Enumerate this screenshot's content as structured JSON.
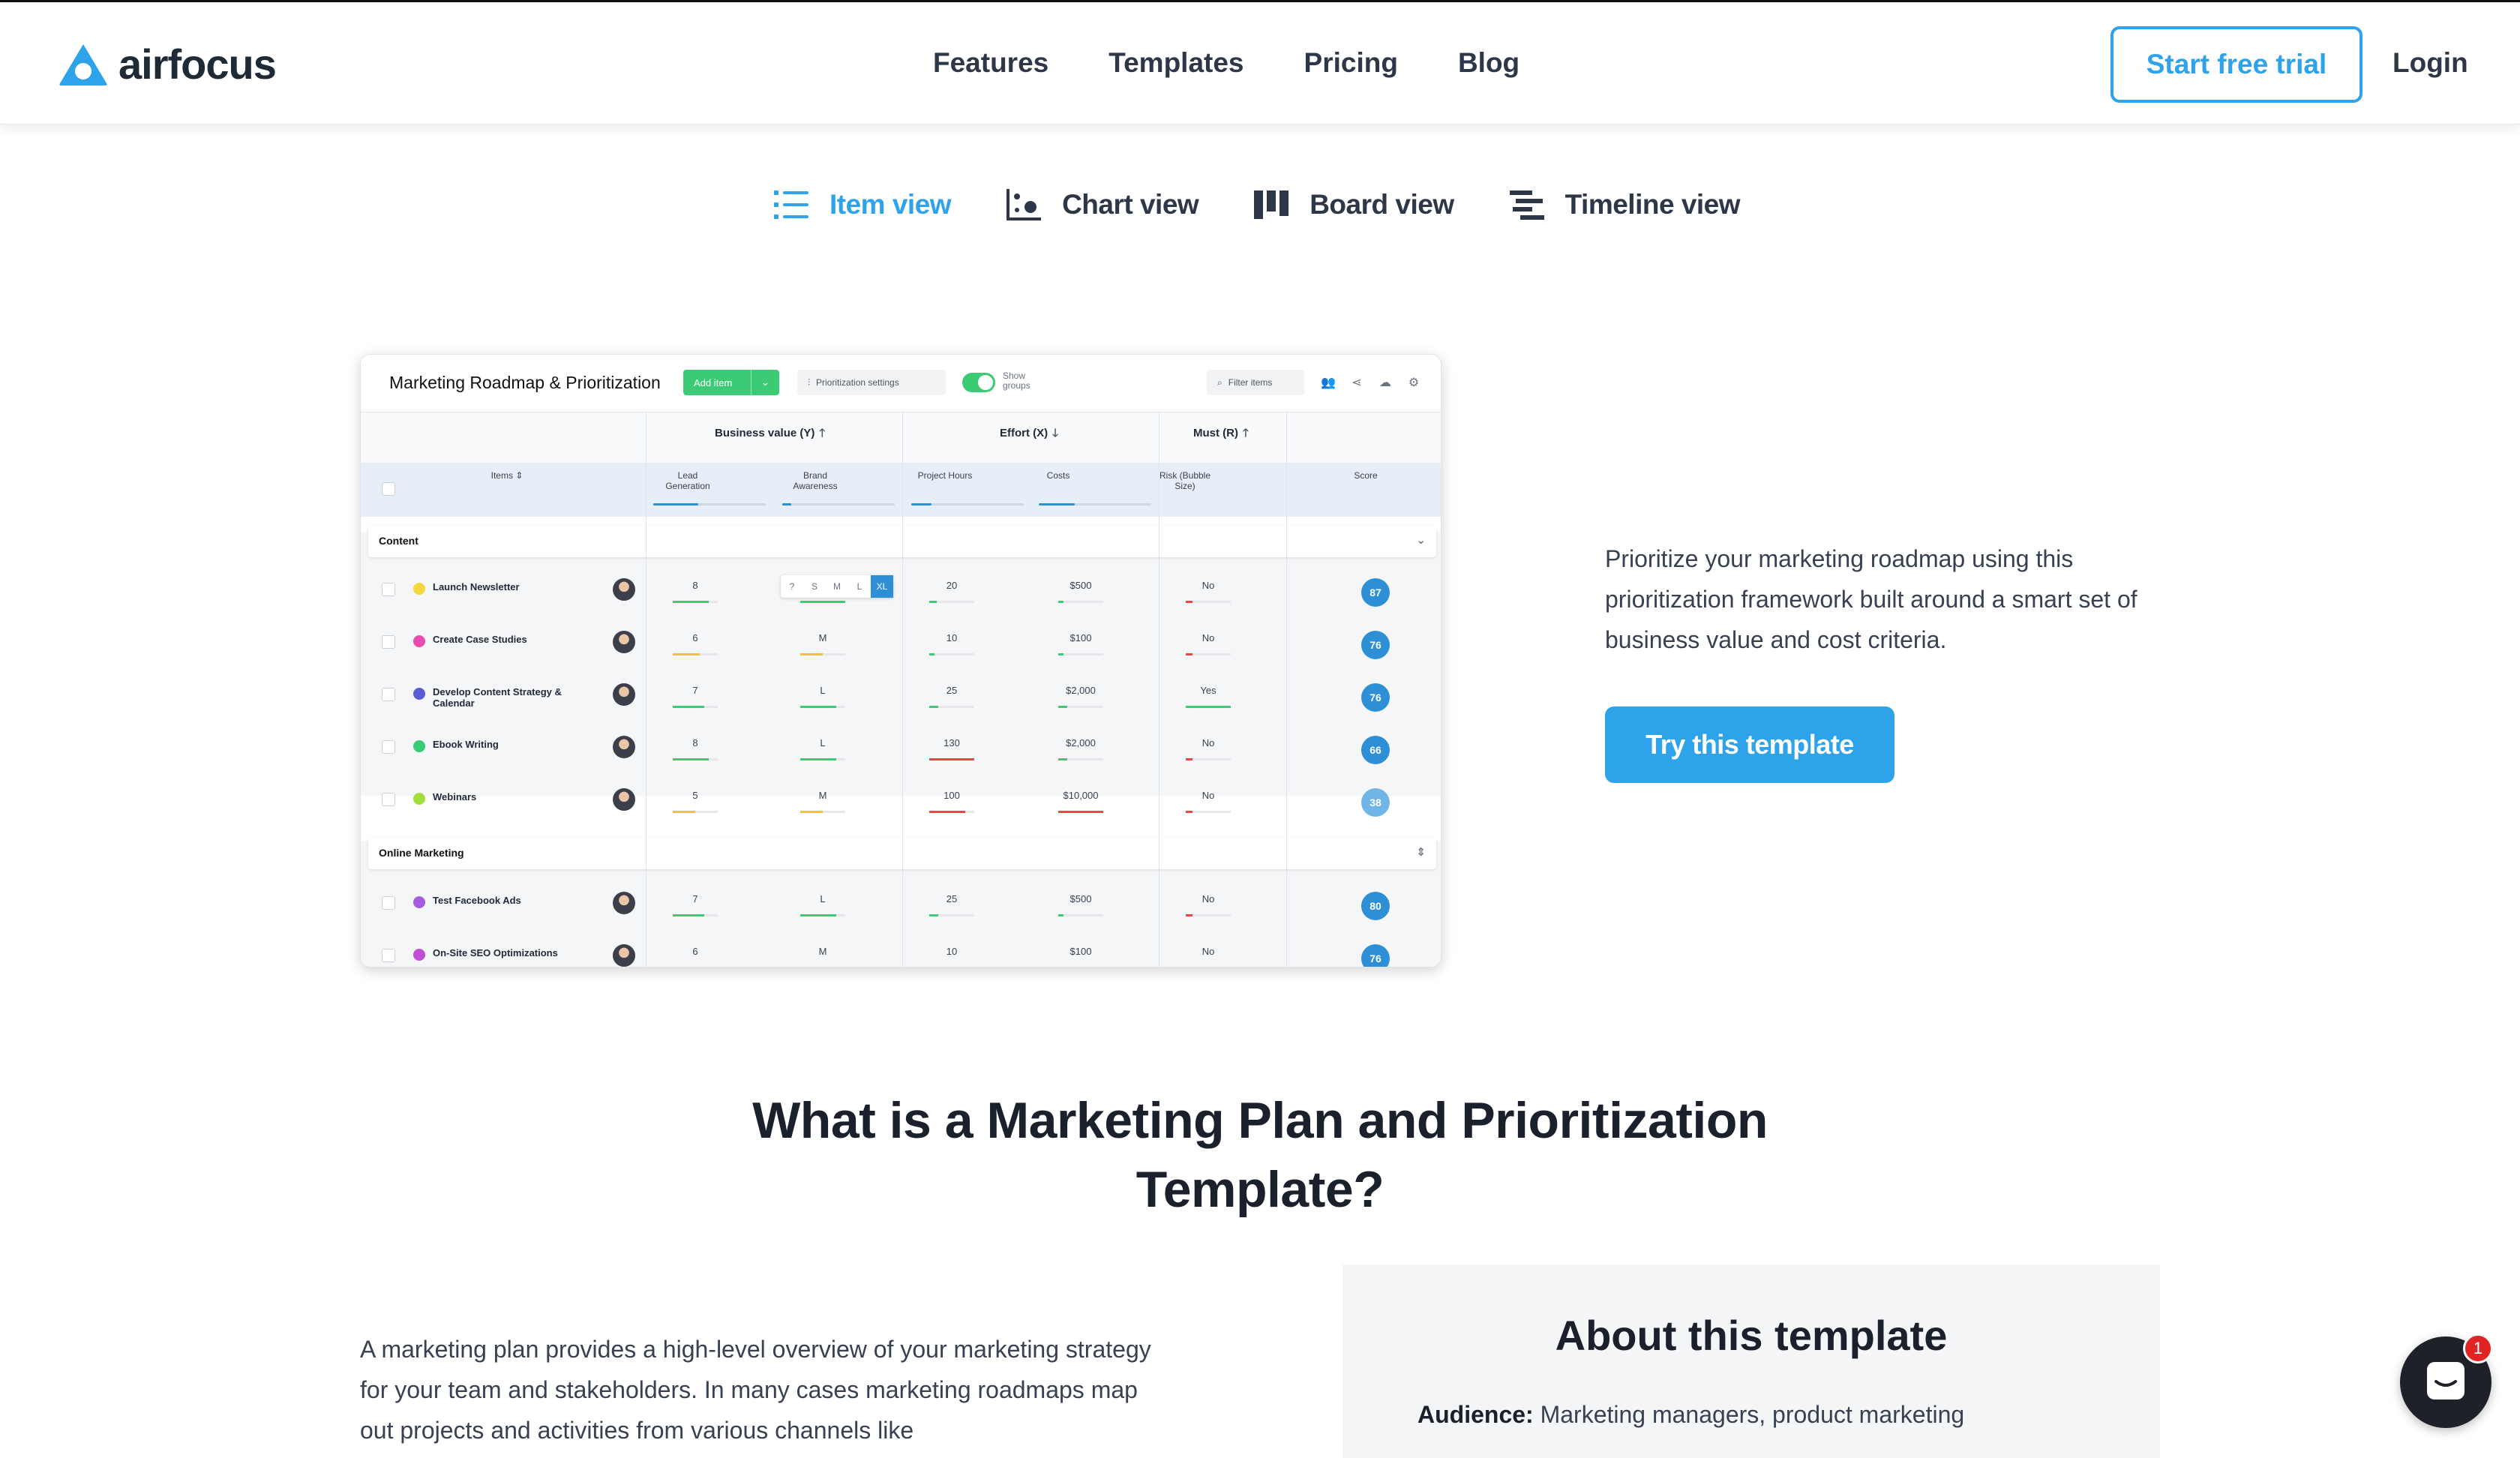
{
  "brand": {
    "name": "airfocus",
    "accent": "#2ea3e9"
  },
  "nav": {
    "links": [
      "Features",
      "Templates",
      "Pricing",
      "Blog"
    ],
    "cta": "Start free trial",
    "login": "Login"
  },
  "views": [
    {
      "label": "Item view",
      "icon": "list-icon",
      "active": true
    },
    {
      "label": "Chart view",
      "icon": "chart-icon",
      "active": false
    },
    {
      "label": "Board view",
      "icon": "board-icon",
      "active": false
    },
    {
      "label": "Timeline view",
      "icon": "timeline-icon",
      "active": false
    }
  ],
  "app": {
    "title": "Marketing Roadmap & Prioritization",
    "add_item": "Add item",
    "prio_settings": "Prioritization settings",
    "show_groups": "Show groups",
    "filter": "Filter items",
    "criteria": {
      "business_value": "Business value (Y)",
      "effort": "Effort (X)",
      "must": "Must (R)"
    },
    "subheaders": {
      "items": "Items",
      "lead_gen": "Lead Generation",
      "brand_awareness": "Brand Awareness",
      "project_hours": "Project Hours",
      "costs": "Costs",
      "risk": "Risk (Bubble Size)",
      "score": "Score"
    },
    "size_options": [
      "?",
      "S",
      "M",
      "L",
      "XL"
    ],
    "groups": [
      {
        "name": "Content",
        "rows": [
          {
            "name": "Launch Newsletter",
            "color": "#f5d63d",
            "lead": "8",
            "brand": "",
            "hours": "20",
            "costs": "$500",
            "must": "No",
            "score": "87"
          },
          {
            "name": "Create Case Studies",
            "color": "#e94bb0",
            "lead": "6",
            "brand": "M",
            "hours": "10",
            "costs": "$100",
            "must": "No",
            "score": "76"
          },
          {
            "name": "Develop Content Strategy & Calendar",
            "color": "#5b5bd6",
            "lead": "7",
            "brand": "L",
            "hours": "25",
            "costs": "$2,000",
            "must": "Yes",
            "score": "76"
          },
          {
            "name": "Ebook Writing",
            "color": "#3bcb75",
            "lead": "8",
            "brand": "L",
            "hours": "130",
            "costs": "$2,000",
            "must": "No",
            "score": "66"
          },
          {
            "name": "Webinars",
            "color": "#a4de3a",
            "lead": "5",
            "brand": "M",
            "hours": "100",
            "costs": "$10,000",
            "must": "No",
            "score": "38"
          }
        ]
      },
      {
        "name": "Online Marketing",
        "rows": [
          {
            "name": "Test Facebook Ads",
            "color": "#a45de0",
            "lead": "7",
            "brand": "L",
            "hours": "25",
            "costs": "$500",
            "must": "No",
            "score": "80"
          },
          {
            "name": "On-Site SEO Optimizations",
            "color": "#c14fd6",
            "lead": "6",
            "brand": "M",
            "hours": "10",
            "costs": "$100",
            "must": "No",
            "score": "76"
          }
        ]
      }
    ]
  },
  "hero": {
    "copy": "Prioritize your marketing roadmap using this prioritization framework built around a smart set of business value and cost criteria.",
    "cta": "Try this template"
  },
  "section": {
    "title_line1": "What is a Marketing Plan and Prioritization",
    "title_line2": "Template?",
    "body": "A marketing plan provides a high-level overview of your marketing strategy for your team and stakeholders. In many cases marketing roadmaps map out projects and activities from various channels like"
  },
  "about": {
    "title": "About this template",
    "audience_label": "Audience:",
    "audience_value": "Marketing managers, product marketing"
  },
  "chat": {
    "badge": "1"
  }
}
